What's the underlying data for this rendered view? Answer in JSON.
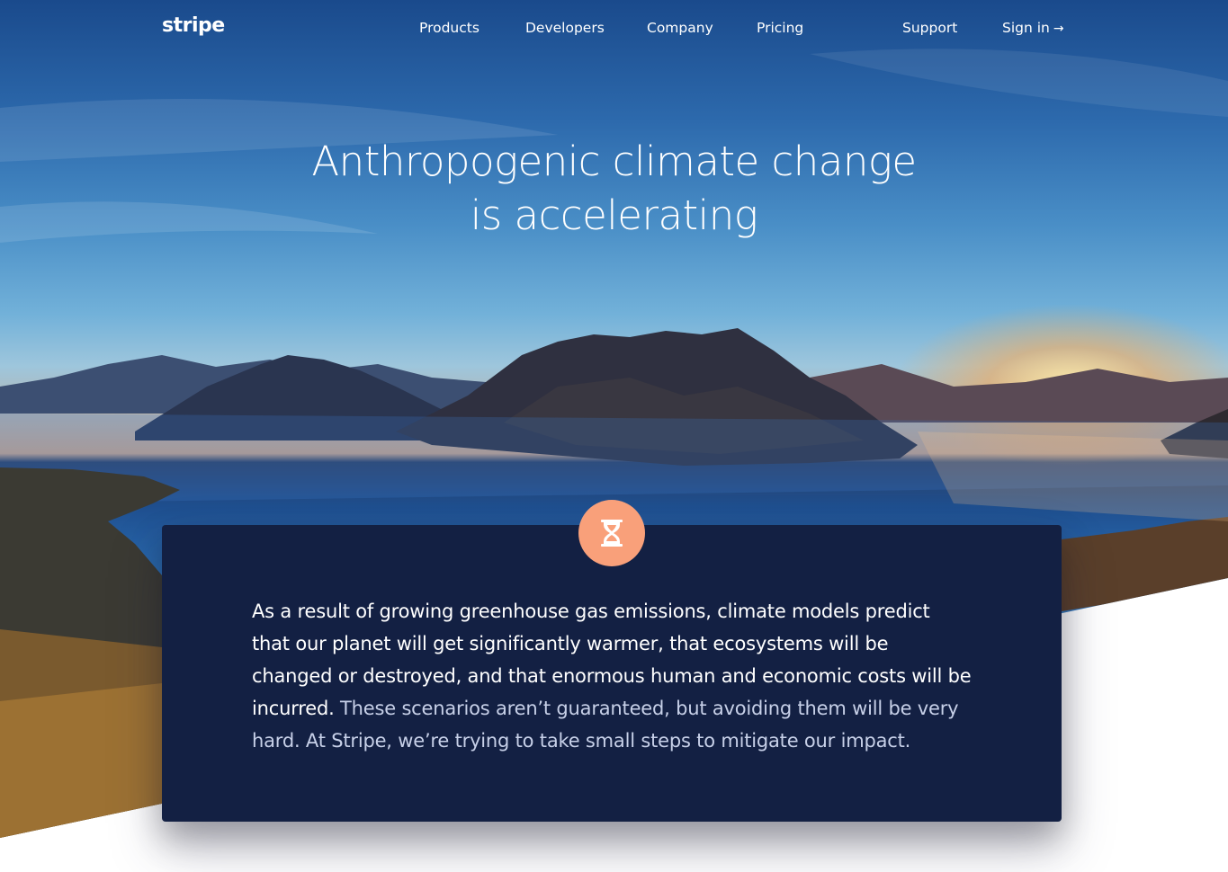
{
  "nav": {
    "logo": "stripe",
    "links": {
      "products": "Products",
      "developers": "Developers",
      "company": "Company",
      "pricing": "Pricing",
      "support": "Support",
      "signin": "Sign in"
    },
    "signin_arrow": "→"
  },
  "hero": {
    "title_line1": "Anthropogenic climate change",
    "title_line2": "is accelerating"
  },
  "card": {
    "icon": "hourglass-icon",
    "text_primary": "As a result of growing greenhouse gas emissions, climate models predict that our planet will get significantly warmer, that ecosystems will be changed or destroyed, and that enormous human and economic costs will be incurred.",
    "text_secondary": "These scenarios aren’t guaranteed, but avoiding them will be very hard. At Stripe, we’re trying to take small steps to mitigate our impact."
  },
  "colors": {
    "card_bg": "#132043",
    "icon_bg": "#f9a07a",
    "text": "#ffffff",
    "text_muted": "#c7d0e8"
  }
}
